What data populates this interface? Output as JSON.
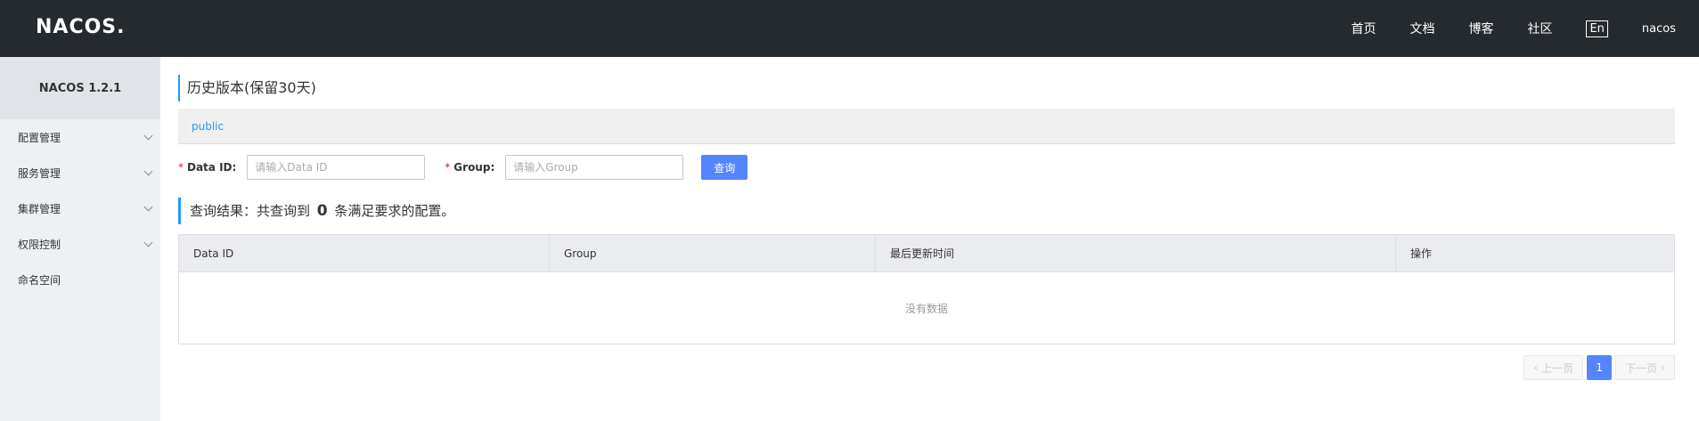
{
  "header": {
    "logo": "NACOS.",
    "nav": [
      "首页",
      "文档",
      "博客",
      "社区"
    ],
    "lang": "En",
    "user": "nacos"
  },
  "sidebar": {
    "title": "NACOS 1.2.1",
    "items": [
      {
        "label": "配置管理",
        "expandable": true
      },
      {
        "label": "服务管理",
        "expandable": true
      },
      {
        "label": "集群管理",
        "expandable": true
      },
      {
        "label": "权限控制",
        "expandable": true
      },
      {
        "label": "命名空间",
        "expandable": false
      }
    ]
  },
  "main": {
    "title": "历史版本(保留30天)",
    "namespace": "public",
    "form": {
      "required_mark": "*",
      "data_id_label": "Data ID:",
      "data_id_placeholder": "请输入Data ID",
      "group_label": "Group:",
      "group_placeholder": "请输入Group",
      "query_button": "查询"
    },
    "result": {
      "prefix": "查询结果：共查询到",
      "count": "0",
      "suffix": "条满足要求的配置。"
    },
    "table": {
      "columns": [
        "Data ID",
        "Group",
        "最后更新时间",
        "操作"
      ],
      "empty_text": "没有数据"
    },
    "pagination": {
      "prev": "上一页",
      "current": "1",
      "next": "下一页"
    }
  }
}
